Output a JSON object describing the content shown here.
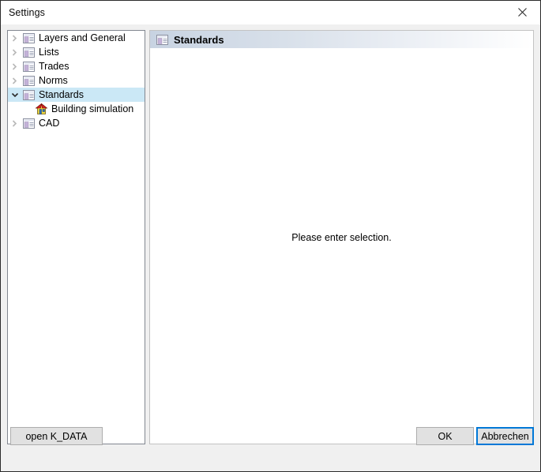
{
  "window": {
    "title": "Settings",
    "close_icon": "close-icon"
  },
  "tree": {
    "items": [
      {
        "label": "Layers and General",
        "icon": "panel-icon",
        "state": "collapsed",
        "level": 0,
        "selected": false
      },
      {
        "label": "Lists",
        "icon": "panel-icon",
        "state": "collapsed",
        "level": 0,
        "selected": false
      },
      {
        "label": "Trades",
        "icon": "panel-icon",
        "state": "collapsed",
        "level": 0,
        "selected": false
      },
      {
        "label": "Norms",
        "icon": "panel-icon",
        "state": "collapsed",
        "level": 0,
        "selected": false
      },
      {
        "label": "Standards",
        "icon": "panel-icon",
        "state": "expanded",
        "level": 0,
        "selected": true
      },
      {
        "label": "Building simulation",
        "icon": "house-icon",
        "state": "leaf",
        "level": 1,
        "selected": false
      },
      {
        "label": "CAD",
        "icon": "panel-icon",
        "state": "collapsed",
        "level": 0,
        "selected": false
      }
    ]
  },
  "detail": {
    "header_icon": "panel-icon",
    "title": "Standards",
    "message": "Please enter selection."
  },
  "footer": {
    "open_kdata_label": "open K_DATA",
    "ok_label": "OK",
    "cancel_label": "Abbrechen"
  },
  "colors": {
    "selection": "#cbe8f6",
    "focus_border": "#0078d7",
    "window_background": "#f0f0f0",
    "panel_background": "#ffffff",
    "header_gradient_start": "#c8d3e2",
    "header_gradient_end": "#ffffff",
    "button_face": "#e1e1e1",
    "button_border": "#adadad",
    "icon_purple": "#b9a7d0",
    "roof_red": "#d32020",
    "roof_yellow": "#f5d93a"
  }
}
